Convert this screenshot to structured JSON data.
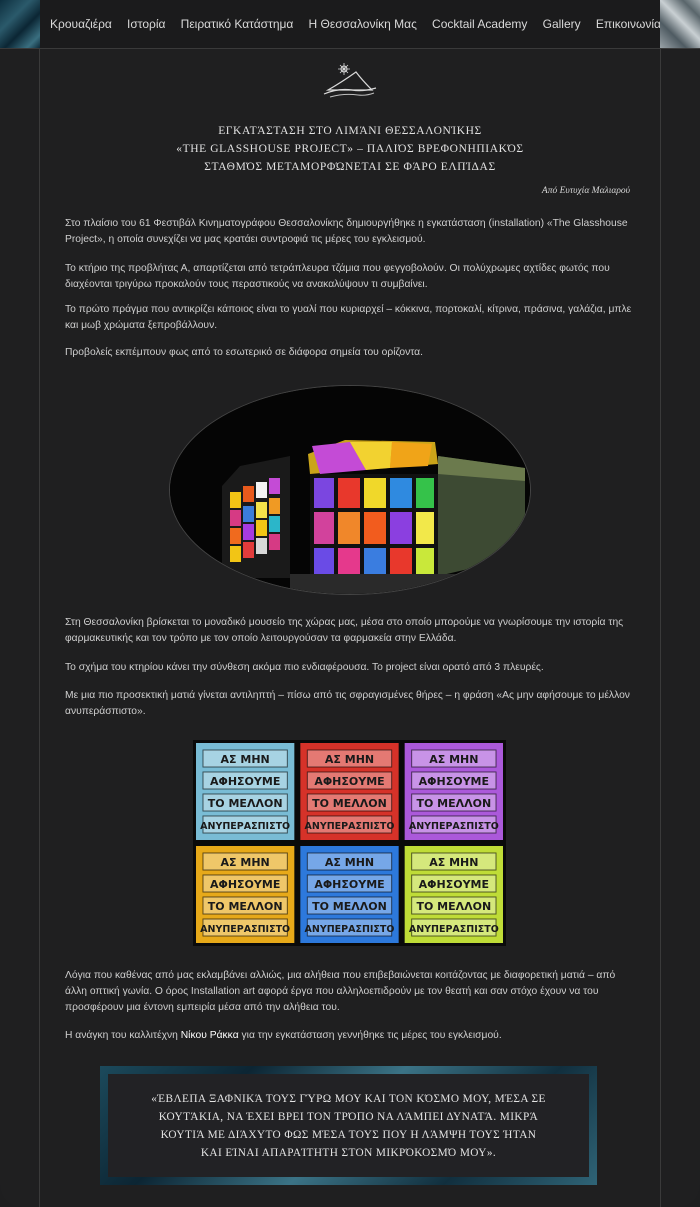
{
  "nav": {
    "items": [
      "Κρουαζιέρα",
      "Ιστορία",
      "Πειρατικό Κατάστημα",
      "Η Θεσσαλονίκη Μας",
      "Cocktail Academy",
      "Gallery",
      "Επικοινωνία"
    ]
  },
  "article": {
    "title_lines": [
      "Εγκατάσταση στο λιμάνι Θεσσαλονίκης",
      "«The Glasshouse Project» – Παλιός Βρεφονηπιακός",
      "Σταθμός μεταμορφώνεται σε φάρο ελπίδας"
    ],
    "author": "Από Ευτυχία Μαλιαρού",
    "paragraphs_top": [
      "Στο πλαίσιο του 61 Φεστιβάλ Κινηματογράφου Θεσσαλονίκης δημιουργήθηκε η εγκατάσταση (installation) «The Glasshouse Project», η οποία συνεχίζει να μας κρατάει συντροφιά τις μέρες του εγκλεισμού.",
      "Το κτήριο της προβλήτας Α, απαρτίζεται από τετράπλευρα τζάμια που φεγγοβολούν. Οι πολύχρωμες αχτίδες φωτός που διαχέονται τριγύρω προκαλούν τους περαστικούς να ανακαλύψουν τι συμβαίνει.",
      "Το πρώτο πράγμα που αντικρίζει κάποιος είναι το γυαλί που κυριαρχεί – κόκκινα, πορτοκαλί, κίτρινα, πράσινα, γαλάζια, μπλε και μωβ χρώματα ξεπροβάλλουν.",
      "Προβολείς εκπέμπουν φως από το εσωτερικό σε διάφορα σημεία του ορίζοντα."
    ],
    "paragraphs_mid": [
      "Στη Θεσσαλονίκη βρίσκεται το μοναδικό μουσείο της χώρας μας, μέσα στο οποίο μπορούμε να γνωρίσουμε την ιστορία της φαρμακευτικής και τον τρόπο με τον οποίο λειτουργούσαν τα φαρμακεία στην Ελλάδα.",
      "Το σχήμα του κτηρίου κάνει την σύνθεση ακόμα πιο ενδιαφέρουσα. Το project είναι ορατό από 3 πλευρές.",
      "Με μια πιο προσεκτική ματιά γίνεται αντιληπτή – πίσω από τις σφραγισμένες θήρες – η φράση «Ας μην αφήσουμε το μέλλον ανυπεράσπιστο»."
    ],
    "paragraph_after_signs": "Λόγια που καθένας από μας εκλαμβάνει αλλιώς, μια αλήθεια που επιβεβαιώνεται κοιτάζοντας με διαφορετική ματιά – από άλλη οπτική γωνία. Ο όρος Installation art αφορά έργα που αλληλοεπιδρούν με τον θεατή και σαν στόχο έχουν να του προσφέρουν μια έντονη εμπειρία μέσα από την αλήθεια του.",
    "artist_paragraph": {
      "before": "Η ανάγκη του καλλιτέχνη ",
      "artist": "Νίκου Ράκκα",
      "after": " για την εγκατάσταση γεννήθηκε τις μέρες του εγκλεισμού."
    },
    "sign_text": [
      "ΑΣ ΜΗΝ",
      "ΑΦΗΣΟΥΜΕ",
      "ΤΟ ΜΕΛΛΟΝ",
      "ΑΝΥΠΕΡΑΣΠΙΣΤΟ"
    ],
    "sign_colors": [
      "#7fc6e0",
      "#e2352b",
      "#b45ee6",
      "#f3b21a",
      "#2f7fe8",
      "#c9e83a"
    ],
    "quote_lines": [
      "«Έβλεπα ξαφνικά τους γύρω μου και τον κόσμο μου, μέσα σε",
      "κουτάκια, να έχει βρει τον τρόπο να λάμπει δυνατά. Μικρά",
      "κουτιά με διάχυτο φως μέσα τους που η λάμψη τους ήταν",
      "και είναι απαραίτητη στον μικρόκοσμό μου»."
    ]
  }
}
